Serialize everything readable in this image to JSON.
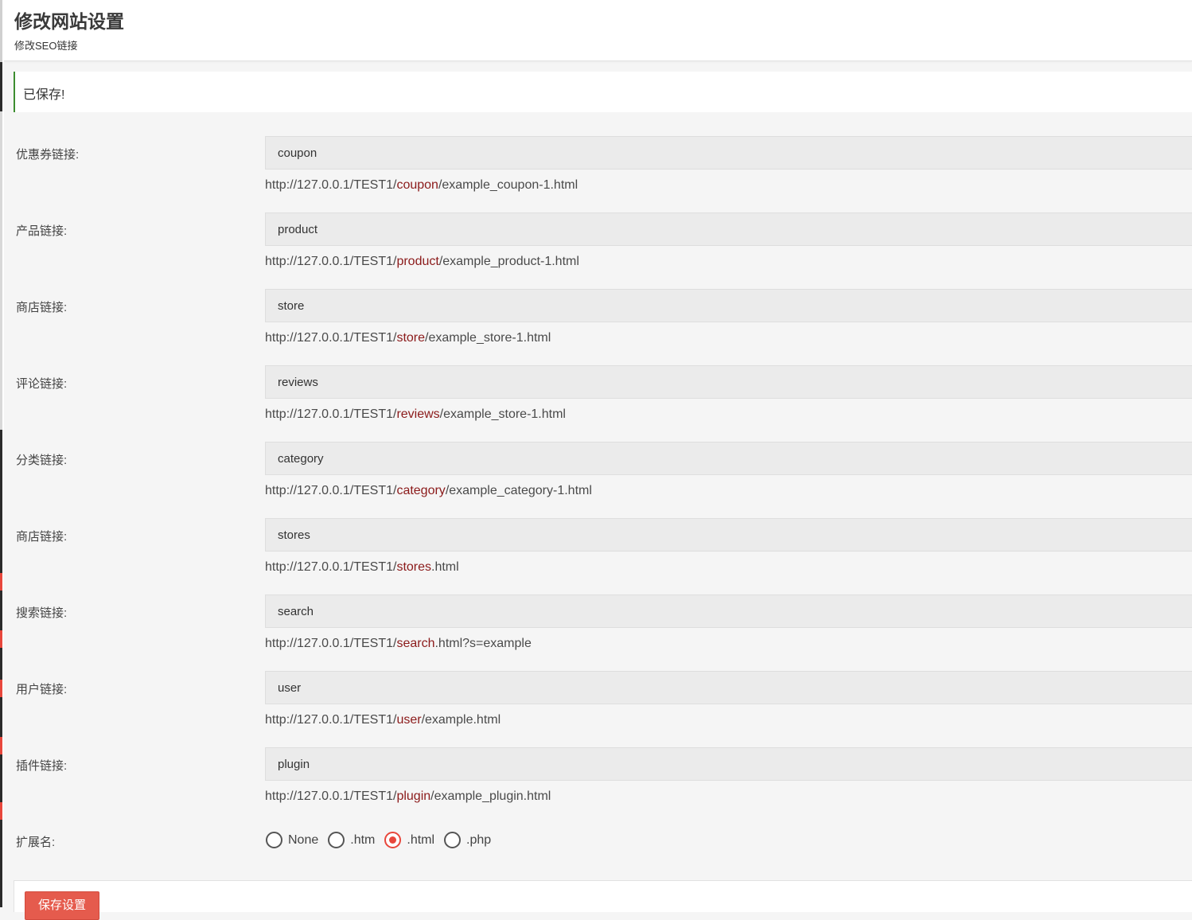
{
  "header": {
    "title": "修改网站设置",
    "subtitle": "修改SEO链接"
  },
  "notice": {
    "text": "已保存!"
  },
  "url_prefix": "http://127.0.0.1/TEST1/",
  "rows": [
    {
      "label": "优惠券链接:",
      "value": "coupon",
      "url_slug": "coupon",
      "url_suffix": "/example_coupon-1.html"
    },
    {
      "label": "产品链接:",
      "value": "product",
      "url_slug": "product",
      "url_suffix": "/example_product-1.html"
    },
    {
      "label": "商店链接:",
      "value": "store",
      "url_slug": "store",
      "url_suffix": "/example_store-1.html"
    },
    {
      "label": "评论链接:",
      "value": "reviews",
      "url_slug": "reviews",
      "url_suffix": "/example_store-1.html"
    },
    {
      "label": "分类链接:",
      "value": "category",
      "url_slug": "category",
      "url_suffix": "/example_category-1.html"
    },
    {
      "label": "商店链接:",
      "value": "stores",
      "url_slug": "stores",
      "url_suffix": ".html"
    },
    {
      "label": "搜索链接:",
      "value": "search",
      "url_slug": "search",
      "url_suffix": ".html?s=example"
    },
    {
      "label": "用户链接:",
      "value": "user",
      "url_slug": "user",
      "url_suffix": "/example.html"
    },
    {
      "label": "插件链接:",
      "value": "plugin",
      "url_slug": "plugin",
      "url_suffix": "/example_plugin.html"
    }
  ],
  "extension": {
    "label": "扩展名:",
    "options": [
      {
        "label": "None",
        "checked": false
      },
      {
        "label": ".htm",
        "checked": false
      },
      {
        "label": ".html",
        "checked": true
      },
      {
        "label": ".php",
        "checked": false
      }
    ]
  },
  "footer": {
    "save_label": "保存设置"
  },
  "colors": {
    "accent": "#e8473c",
    "slug": "#8b1a1a",
    "notice_border": "#3c8d2f",
    "button": "#e55b4d"
  }
}
